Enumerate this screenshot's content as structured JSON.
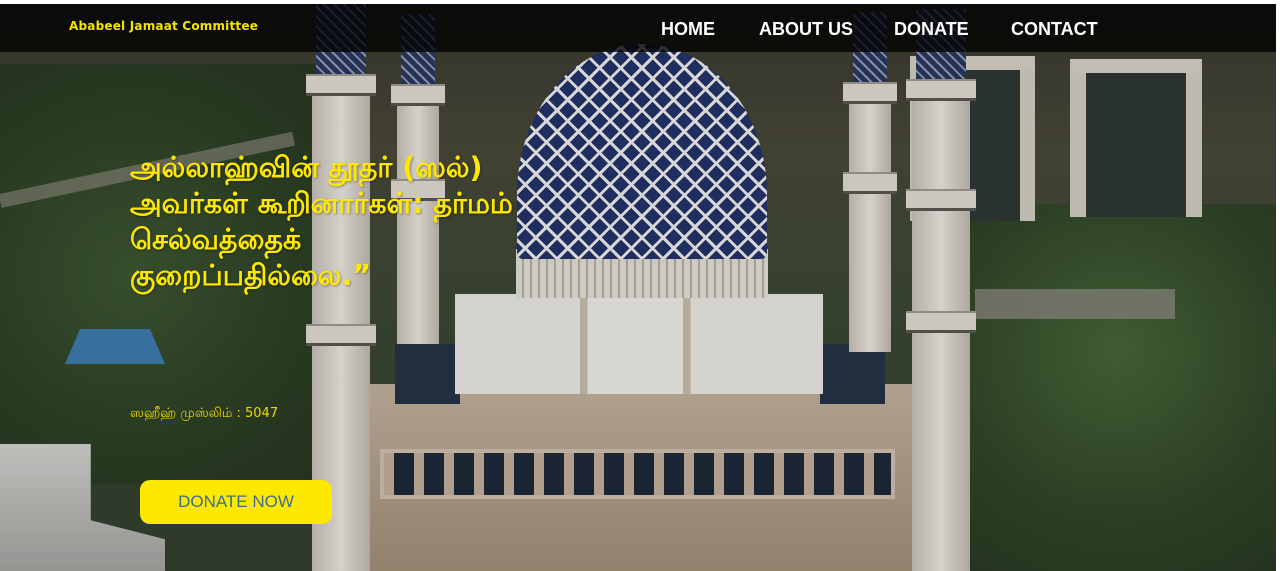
{
  "navbar": {
    "brand": "Ababeel Jamaat Committee",
    "links": [
      {
        "label": "HOME"
      },
      {
        "label": "ABOUT US"
      },
      {
        "label": "DONATE"
      },
      {
        "label": "CONTACT"
      }
    ]
  },
  "hero": {
    "headline": "அல்லாஹ்வின் தூதர் (ஸல்) அவர்கள் கூறினார்கள்: தர்மம் செல்வத்தைக் குறைப்பதில்லை.”",
    "citation": "ஸஹீஹ் முஸ்லிம் : 5047",
    "donate_button": "DONATE NOW",
    "background_image": "aerial view of a mosque with blue and white dome and minarets"
  },
  "colors": {
    "accent_yellow": "#ffe800",
    "navbar_bg": "#000000",
    "button_text": "#3e6f8a"
  }
}
